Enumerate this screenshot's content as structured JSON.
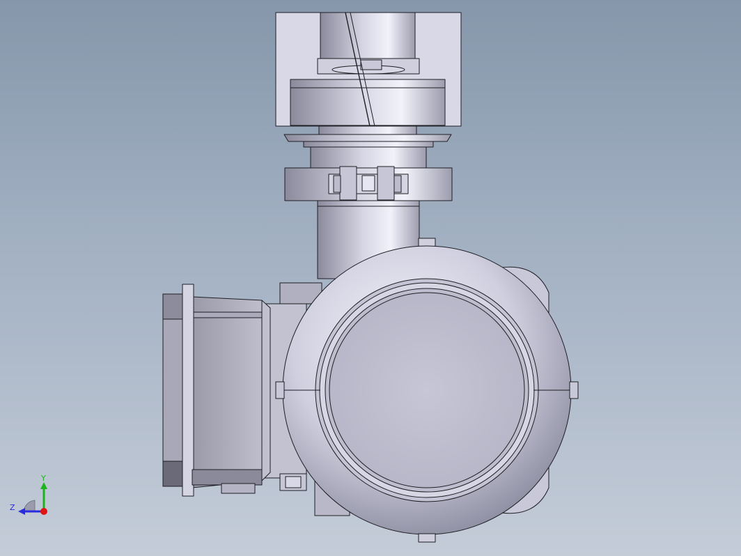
{
  "viewport": {
    "background_top": "#8697ab",
    "background_bottom": "#c4ccd8",
    "part_fill": "#c4c4d6",
    "part_highlight": "#eeeefa",
    "part_shadow": "#7f7f92",
    "edge_color": "#1e1e24"
  },
  "triad": {
    "y_label": "Y",
    "z_label": "Z",
    "y_color": "#1db31d",
    "z_color": "#2a2adf",
    "x_color": "#e01414"
  }
}
